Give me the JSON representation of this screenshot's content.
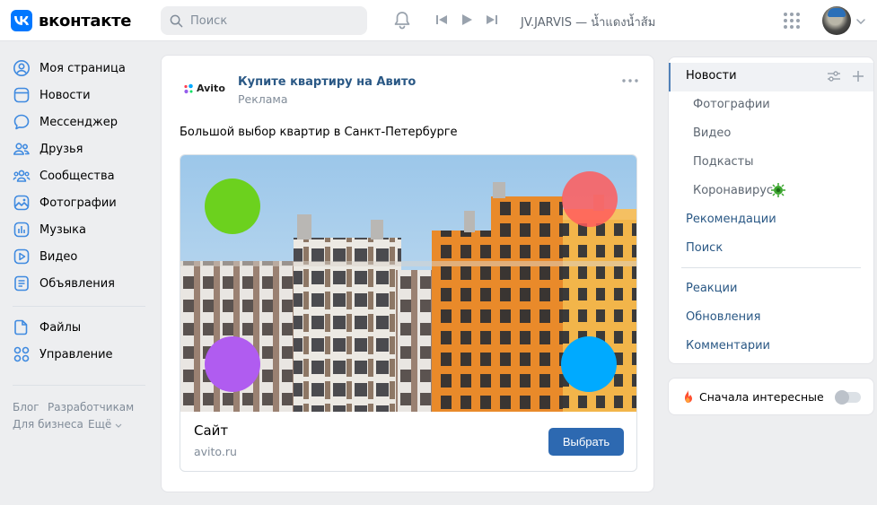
{
  "brand": {
    "name": "вконтакте",
    "accent": "#0077ff"
  },
  "search": {
    "placeholder": "Поиск"
  },
  "player": {
    "track": "JV.JARVIS — น้ำแดงน้ำส้ม"
  },
  "leftnav": {
    "items": [
      {
        "label": "Моя страница",
        "icon": "user-icon"
      },
      {
        "label": "Новости",
        "icon": "news-icon"
      },
      {
        "label": "Мессенджер",
        "icon": "message-icon"
      },
      {
        "label": "Друзья",
        "icon": "friends-icon"
      },
      {
        "label": "Сообщества",
        "icon": "communities-icon"
      },
      {
        "label": "Фотографии",
        "icon": "photo-icon"
      },
      {
        "label": "Музыка",
        "icon": "music-icon"
      },
      {
        "label": "Видео",
        "icon": "video-icon"
      },
      {
        "label": "Объявления",
        "icon": "classifieds-icon"
      },
      {
        "label": "Файлы",
        "icon": "files-icon"
      },
      {
        "label": "Управление",
        "icon": "apps-icon"
      }
    ],
    "footer": {
      "blog": "Блог",
      "developers": "Разработчикам",
      "business": "Для бизнеса",
      "more": "Ещё"
    }
  },
  "post": {
    "advertiser_logo": "Avito",
    "advertiser_name": "Купите квартиру на Авито",
    "label": "Реклама",
    "text": "Большой выбор квартир в Санкт-Петербурге",
    "card": {
      "title": "Сайт",
      "domain": "avito.ru",
      "button": "Выбрать"
    }
  },
  "rightpanel": {
    "news": "Новости",
    "subitems": [
      "Фотографии",
      "Видео",
      "Подкасты",
      "Коронавирус"
    ],
    "recommendations": "Рекомендации",
    "search": "Поиск",
    "reactions": "Реакции",
    "updates": "Обновления",
    "comments": "Комментарии"
  },
  "sort": {
    "label": "Сначала интересные",
    "enabled": false
  }
}
